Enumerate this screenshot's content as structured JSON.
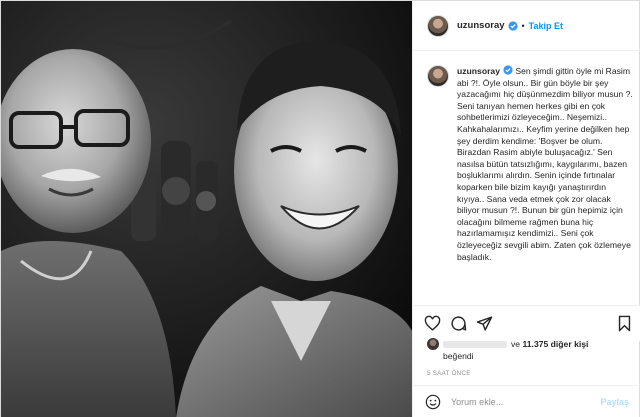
{
  "post": {
    "username": "uzunsoray",
    "follow_label": "Takip Et",
    "dot": "•",
    "caption_username": "uzunsoray",
    "caption_text": " Sen şimdi gittin öyle mi Rasim abi ?!. Öyle olsun.. Bir gün böyle bir şey yazacağımı hiç düşünmezdim biliyor musun ?. Seni tanıyan hemen herkes gibi en çok sohbetlerimizi özleyeceğim.. Neşemizi.. Kahkahalarımızı.. Keyfim yerine değilken hep şey derdim kendime: 'Boşver be olum. Birazdan Rasim abiyle buluşacağız.' Sen nasılsa bütün tatsızlığımı, kaygılarımı, bazen boşluklarımı alırdın. Senin içinde fırtınalar koparken bile bizim kayığı yanaştırırdın kıyıya.. Sana veda etmek çok zor olacak biliyor musun ?!. Bunun bir gün hepimiz için olacağını bilmeme rağmen buna hiç hazırlamamışız kendimizi.. Seni çok özleyeceğiz sevgili abim. Zaten çok özlemeye başladık.",
    "likes_prefix": "ve",
    "likes_count": "11.375 diğer kişi",
    "likes_suffix": "beğendi",
    "time_ago": "5 SAAT ÖNCE",
    "comment_placeholder": "Yorum ekle...",
    "share_label": "Paylaş"
  },
  "icons": {
    "verified": "verified-badge-icon",
    "like": "heart-icon",
    "comment": "comment-bubble-icon",
    "share": "paper-plane-icon",
    "save": "bookmark-icon",
    "emoji": "smiley-icon"
  },
  "colors": {
    "link_blue": "#0095f6",
    "share_disabled": "#b2dffc",
    "muted": "#8e8e8e",
    "border": "#efefef"
  }
}
